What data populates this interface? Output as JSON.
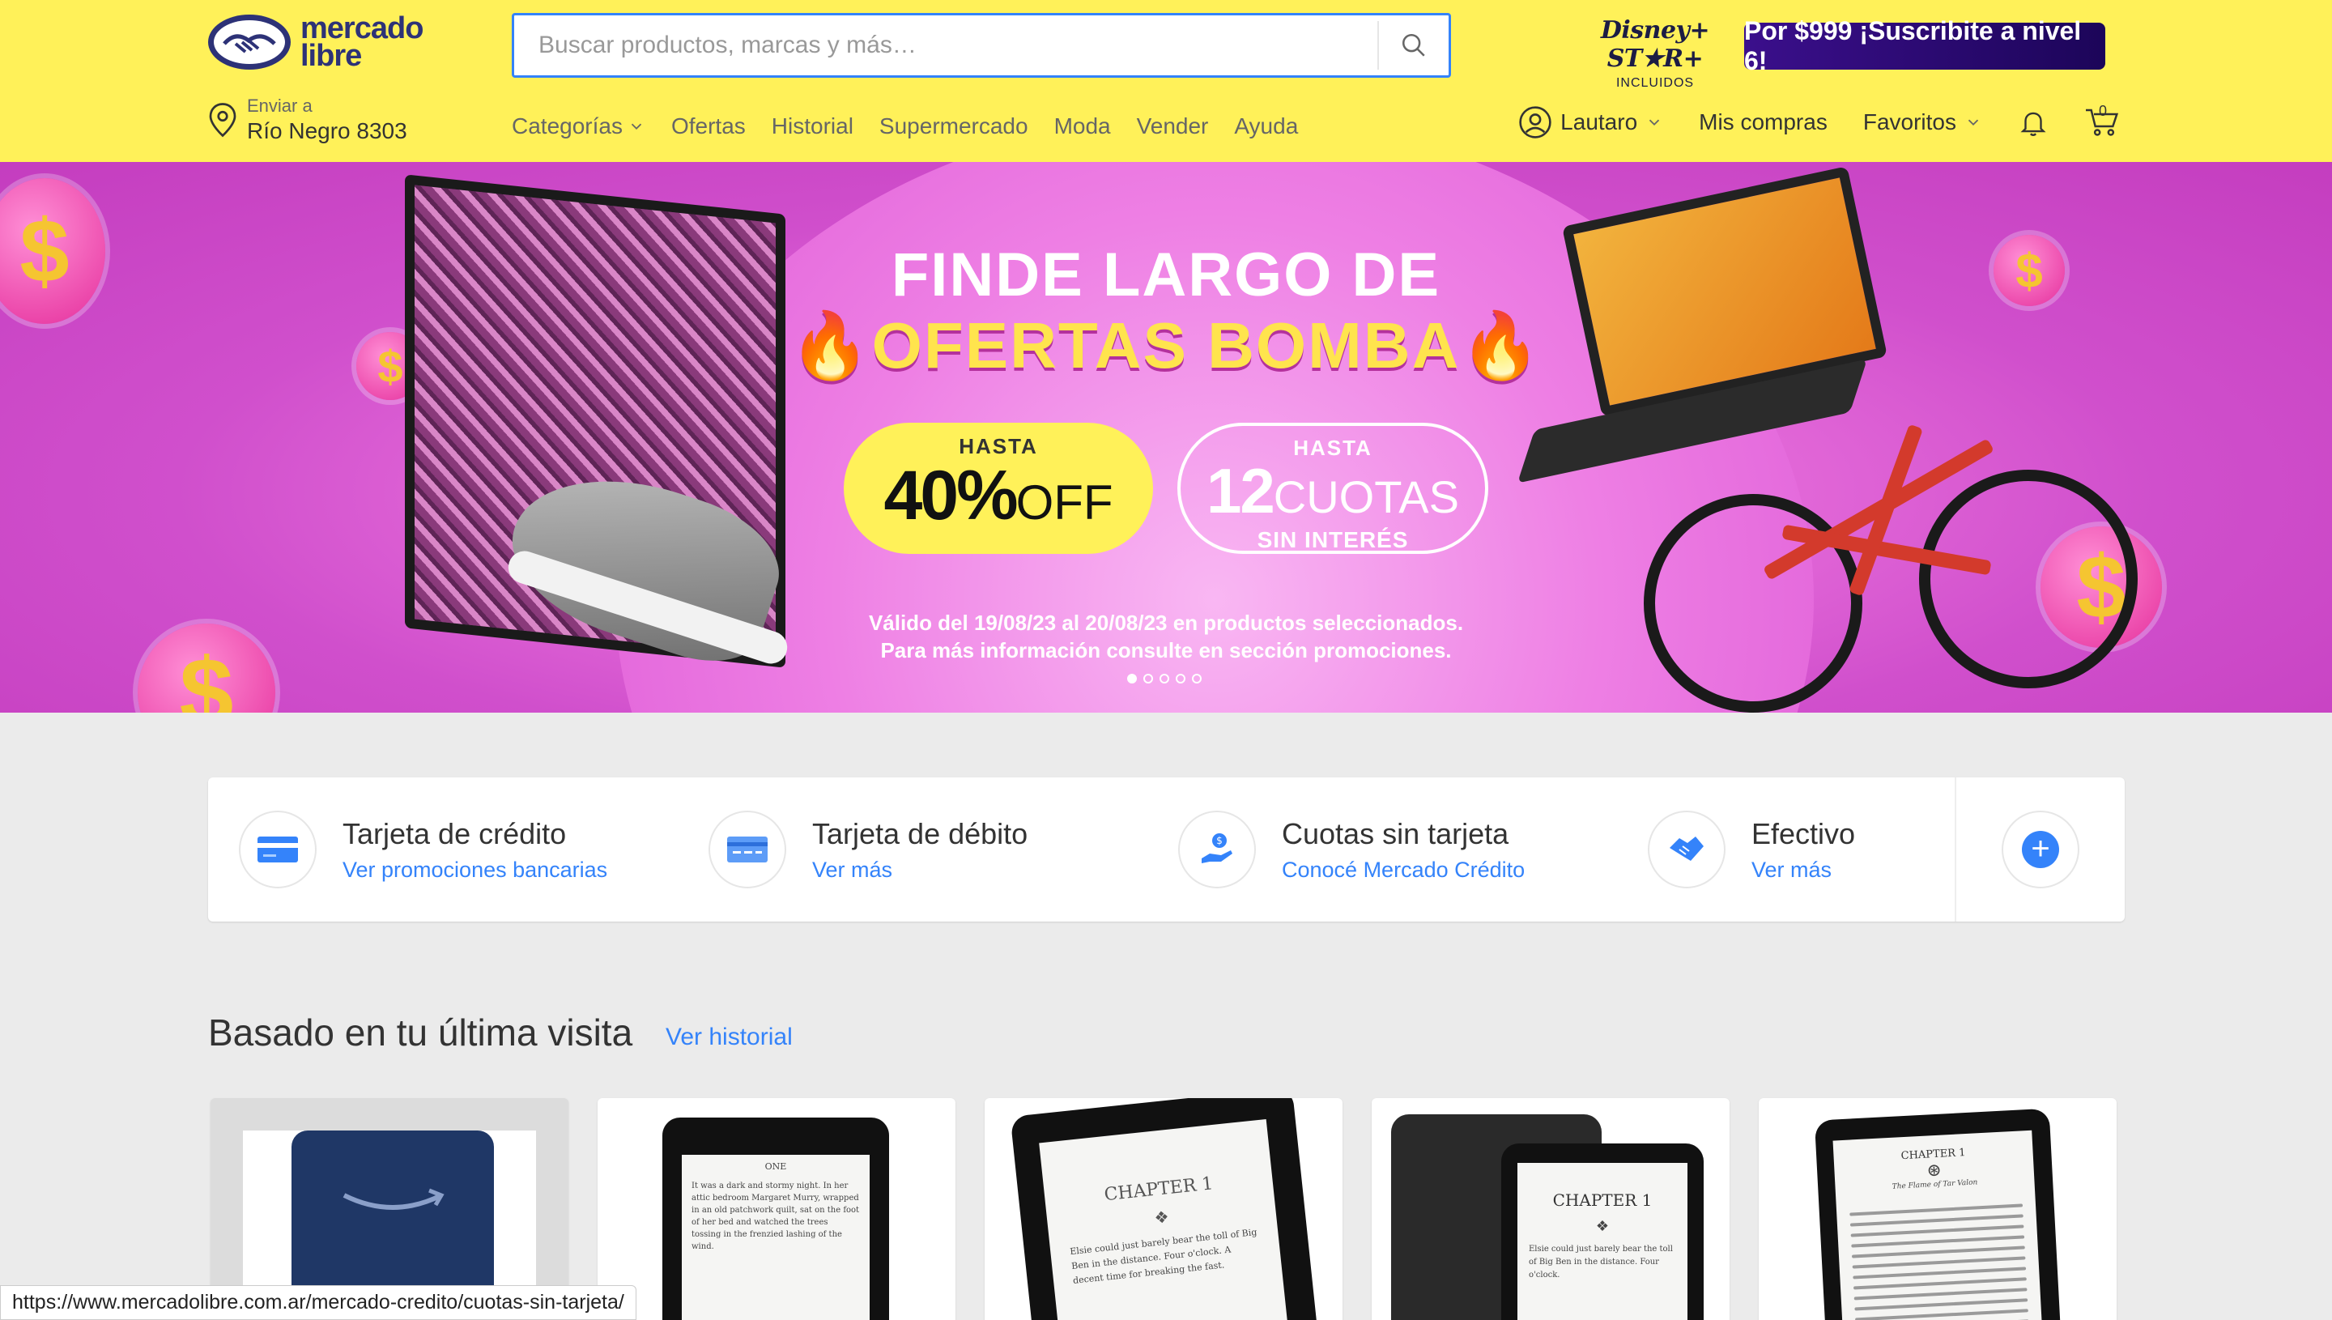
{
  "header": {
    "logo_text_1": "mercado",
    "logo_text_2": "libre",
    "search_placeholder": "Buscar productos, marcas y más…",
    "disney_logo": "Disney+ ST★R+",
    "disney_sub": "INCLUIDOS",
    "promo": "Por $999 ¡Suscribite a nivel 6!",
    "location_label": "Enviar a",
    "location_address": "Río Negro 8303",
    "nav": [
      "Categorías",
      "Ofertas",
      "Historial",
      "Supermercado",
      "Moda",
      "Vender",
      "Ayuda"
    ],
    "user": "Lautaro",
    "purchases": "Mis compras",
    "favorites": "Favoritos",
    "cart_count": "0"
  },
  "banner": {
    "title_line1": "FINDE LARGO DE",
    "title_line2": "OFERTAS BOMBA",
    "discount_label": "HASTA",
    "discount_value": "40%",
    "discount_suffix": "OFF",
    "cuotas_label": "HASTA",
    "cuotas_value": "12",
    "cuotas_suffix": "CUOTAS",
    "cuotas_sub": "SIN INTERÉS",
    "legal_line1": "Válido del 19/08/23 al 20/08/23 en productos seleccionados.",
    "legal_line2": "Para más información consulte en sección promociones.",
    "slides_total": 5,
    "active_slide": 1
  },
  "payment": {
    "items": [
      {
        "title": "Tarjeta de crédito",
        "link": "Ver promociones bancarias",
        "icon": "credit-card-icon"
      },
      {
        "title": "Tarjeta de débito",
        "link": "Ver más",
        "icon": "debit-card-icon"
      },
      {
        "title": "Cuotas sin tarjeta",
        "link": "Conocé Mercado Crédito",
        "icon": "hand-coin-icon"
      },
      {
        "title": "Efectivo",
        "link": "Ver más",
        "icon": "handshake-icon"
      }
    ]
  },
  "section": {
    "title": "Basado en tu última visita",
    "link": "Ver historial"
  },
  "products": {
    "card2_header": "ONE",
    "card3_heading": "CHAPTER 1",
    "card4_heading": "CHAPTER 1",
    "card5_heading": "CHAPTER 1",
    "card5_sub": "The Flame of Tar Valon",
    "card3_text": "Elsie could just barely bear the toll of Big Ben in the distance. Four o'clock. A decent time for breaking the fast.",
    "card4_text": "Elsie could just barely bear the toll of Big Ben in the distance. Four o'clock.",
    "card2_text": "It was a dark and stormy night. In her attic bedroom Margaret Murry, wrapped in an old patchwork quilt, sat on the foot of her bed and watched the trees tossing in the frenzied lashing of the wind."
  },
  "status_url": "https://www.mercadolibre.com.ar/mercado-credito/cuotas-sin-tarjeta/",
  "colors": {
    "header_bg": "#fff159",
    "accent": "#3483fa",
    "promo_bg": "#3b0f8c",
    "banner_pink": "#e46ad9"
  }
}
